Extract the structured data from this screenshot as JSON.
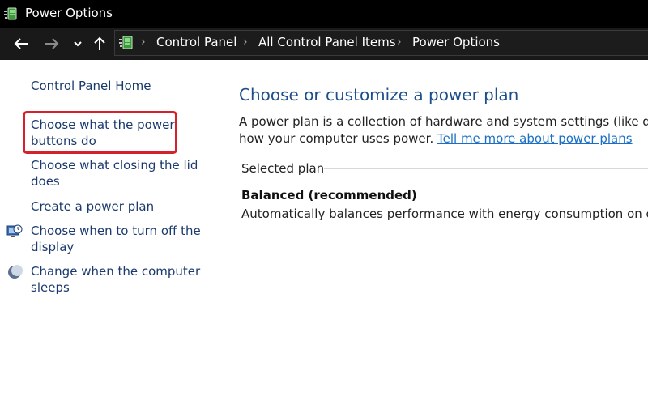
{
  "window": {
    "title": "Power Options"
  },
  "breadcrumb": {
    "items": [
      "Control Panel",
      "All Control Panel Items",
      "Power Options"
    ]
  },
  "sidebar": {
    "home": "Control Panel Home",
    "links": [
      {
        "line1": "Choose what the power",
        "line2": "buttons do",
        "icon": "none"
      },
      {
        "line1": "Choose what closing the lid",
        "line2": "does",
        "icon": "none"
      },
      {
        "line1": "Create a power plan",
        "line2": "",
        "icon": "none"
      },
      {
        "line1": "Choose when to turn off the",
        "line2": "display",
        "icon": "display-clock-icon"
      },
      {
        "line1": "Change when the computer",
        "line2": "sleeps",
        "icon": "moon-icon"
      }
    ]
  },
  "main": {
    "heading": "Choose or customize a power plan",
    "desc_line1": "A power plan is a collection of hardware and system settings (like display",
    "desc_line2": "how your computer uses power.",
    "desc_link": "Tell me more about power plans",
    "group_label": "Selected plan",
    "plan_name": "Balanced (recommended)",
    "plan_desc": "Automatically balances performance with energy consumption on capa"
  },
  "colors": {
    "link": "#1a3a6e",
    "heading": "#1e4f8c",
    "highlight": "#d4212b"
  }
}
